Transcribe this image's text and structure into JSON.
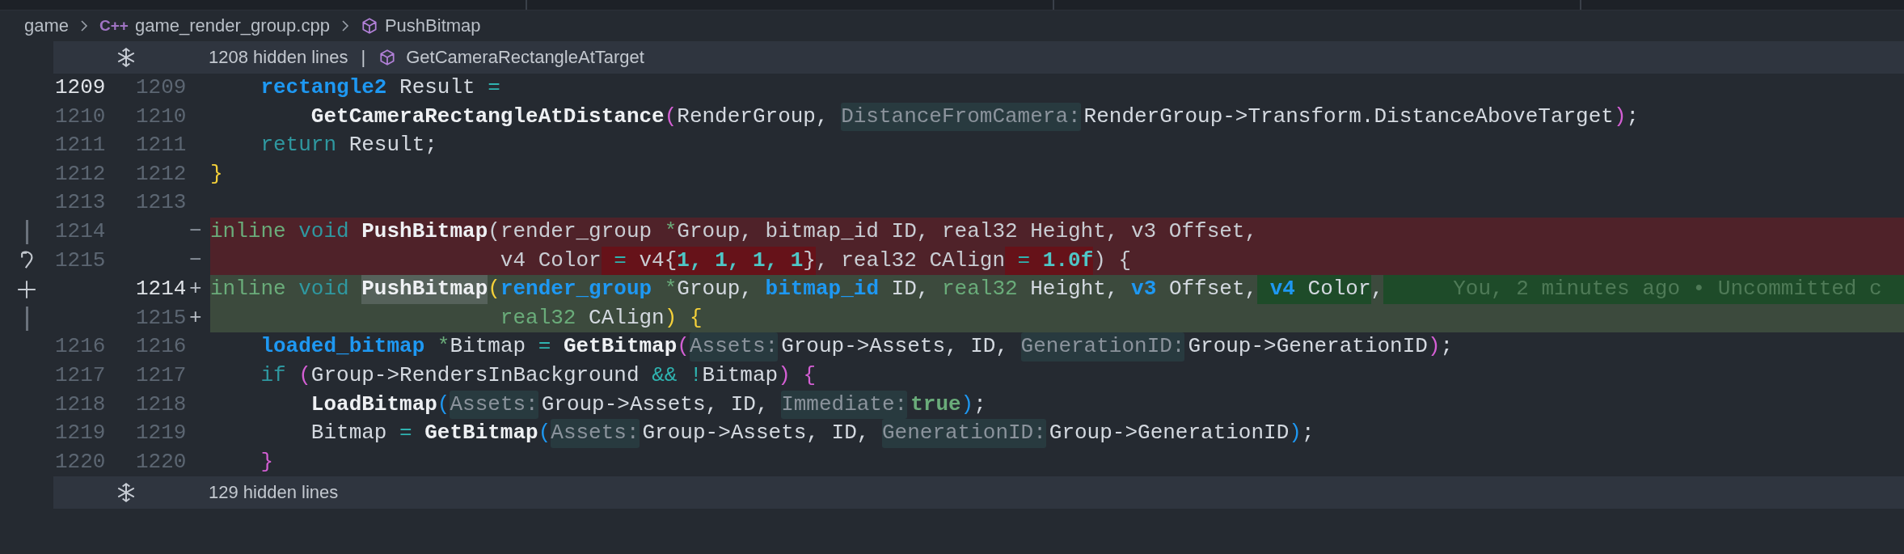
{
  "breadcrumb": [
    {
      "label": "game",
      "kind": "folder"
    },
    {
      "label": "game_render_group.cpp",
      "kind": "file",
      "icon_text": "C++"
    },
    {
      "label": "PushBitmap",
      "kind": "symbol"
    }
  ],
  "top_fold": {
    "label": "1208 hidden lines",
    "separator": "|",
    "symbol": "GetCameraRectangleAtTarget"
  },
  "lines": [
    {
      "old": "1209",
      "new": "1209",
      "kind": "context",
      "current": true,
      "tokens": [
        {
          "t": "    rectangle2",
          "kind": "type"
        },
        {
          "t": " Result ",
          "kind": "plain"
        },
        {
          "t": "=",
          "kind": "op"
        }
      ]
    },
    {
      "old": "1210",
      "new": "1210",
      "kind": "context",
      "current": false,
      "tokens": [
        {
          "t": "        GetCameraRectangleAtDistance",
          "kind": "func"
        },
        {
          "t": "(",
          "kind": "pink"
        },
        {
          "t": "RenderGroup, ",
          "kind": "plain"
        },
        {
          "t": "DistanceFromCamera:",
          "kind": "hint"
        },
        {
          "t": "RenderGroup->Transform.DistanceAboveTarget",
          "kind": "plain"
        },
        {
          "t": ")",
          "kind": "pink"
        },
        {
          "t": ";",
          "kind": "plain"
        }
      ]
    },
    {
      "old": "1211",
      "new": "1211",
      "kind": "context",
      "current": false,
      "tokens": [
        {
          "t": "    return",
          "kind": "kw"
        },
        {
          "t": " Result;",
          "kind": "plain"
        }
      ]
    },
    {
      "old": "1212",
      "new": "1212",
      "kind": "context",
      "current": false,
      "tokens": [
        {
          "t": "}",
          "kind": "yellow"
        }
      ]
    },
    {
      "old": "1213",
      "new": "1213",
      "kind": "context",
      "current": false
    },
    {
      "old": "1214",
      "kind": "deleted",
      "sign": "−",
      "gutter": {
        "kind": "bar"
      },
      "current": false,
      "tokens": [
        {
          "t": "inline",
          "kind": "green"
        },
        {
          "t": " void",
          "kind": "kw"
        },
        {
          "t": " PushBitmap",
          "kind": "func"
        },
        {
          "t": "(render_group ",
          "kind": "plain"
        },
        {
          "t": "*",
          "kind": "ptr"
        },
        {
          "t": "Group, bitmap_id ID, real32 Height, v3 Offset,",
          "kind": "plain"
        }
      ]
    },
    {
      "old": "1215",
      "kind": "deleted",
      "sign": "−",
      "gutter": {
        "kind": "revert"
      },
      "current": false,
      "tokens": [
        {
          "t": "                       v4 Color",
          "kind": "plain"
        },
        {
          "t": " =",
          "kind": "op",
          "changed": true
        },
        {
          "t": " v4{",
          "kind": "plain",
          "changed": true
        },
        {
          "t": "1, 1, 1, 1",
          "kind": "num",
          "changed": true
        },
        {
          "t": "}",
          "kind": "plain",
          "changed": true
        },
        {
          "t": ", real32 CAlign",
          "kind": "plain"
        },
        {
          "t": " =",
          "kind": "op",
          "changed": true
        },
        {
          "t": " 1.0f",
          "kind": "num",
          "changed": true
        },
        {
          "t": ") {",
          "kind": "plain"
        }
      ]
    },
    {
      "new": "1214",
      "kind": "added",
      "sign": "+",
      "gutter": {
        "kind": "plus"
      },
      "current": true,
      "blame": "You, 2 minutes ago • Uncommitted c",
      "tokens": [
        {
          "t": "inline",
          "kind": "green"
        },
        {
          "t": " void ",
          "kind": "kw"
        },
        {
          "t": "PushBitmap",
          "kind": "func",
          "changed": true
        },
        {
          "t": "(",
          "kind": "yellow"
        },
        {
          "t": "render_group",
          "kind": "type"
        },
        {
          "t": " *",
          "kind": "ptr"
        },
        {
          "t": "Group, ",
          "kind": "plain"
        },
        {
          "t": "bitmap_id",
          "kind": "type"
        },
        {
          "t": " ID, ",
          "kind": "plain"
        },
        {
          "t": "real32",
          "kind": "green"
        },
        {
          "t": " Height, ",
          "kind": "plain"
        },
        {
          "t": "v3",
          "kind": "type"
        },
        {
          "t": " Offset,",
          "kind": "plain"
        },
        {
          "t": " v4",
          "kind": "type",
          "changed": true
        },
        {
          "t": " Color",
          "kind": "plain",
          "changed": true
        },
        {
          "t": ",",
          "kind": "plain"
        }
      ]
    },
    {
      "new": "1215",
      "kind": "added",
      "sign": "+",
      "gutter": {
        "kind": "bar"
      },
      "current": false,
      "tokens": [
        {
          "t": "                       real32",
          "kind": "green"
        },
        {
          "t": " CAlign",
          "kind": "plain"
        },
        {
          "t": ")",
          "kind": "yellow"
        },
        {
          "t": " {",
          "kind": "yellow"
        }
      ]
    },
    {
      "old": "1216",
      "new": "1216",
      "kind": "context",
      "current": false,
      "tokens": [
        {
          "t": "    loaded_bitmap",
          "kind": "type"
        },
        {
          "t": " *",
          "kind": "ptr"
        },
        {
          "t": "Bitmap ",
          "kind": "plain"
        },
        {
          "t": "=",
          "kind": "op"
        },
        {
          "t": " GetBitmap",
          "kind": "func"
        },
        {
          "t": "(",
          "kind": "pink"
        },
        {
          "t": "Assets:",
          "kind": "hint"
        },
        {
          "t": "Group->Assets, ID, ",
          "kind": "plain"
        },
        {
          "t": "GenerationID:",
          "kind": "hint"
        },
        {
          "t": "Group->GenerationID",
          "kind": "plain"
        },
        {
          "t": ")",
          "kind": "pink"
        },
        {
          "t": ";",
          "kind": "plain"
        }
      ]
    },
    {
      "old": "1217",
      "new": "1217",
      "kind": "context",
      "current": false,
      "tokens": [
        {
          "t": "    if",
          "kind": "kw"
        },
        {
          "t": " (",
          "kind": "pink"
        },
        {
          "t": "Group->RendersInBackground ",
          "kind": "plain"
        },
        {
          "t": "&& !",
          "kind": "op"
        },
        {
          "t": "Bitmap",
          "kind": "plain"
        },
        {
          "t": ")",
          "kind": "pink"
        },
        {
          "t": " {",
          "kind": "pink"
        }
      ]
    },
    {
      "old": "1218",
      "new": "1218",
      "kind": "context",
      "current": false,
      "tokens": [
        {
          "t": "        LoadBitmap",
          "kind": "func"
        },
        {
          "t": "(",
          "kind": "blue"
        },
        {
          "t": "Assets:",
          "kind": "hint"
        },
        {
          "t": "Group->Assets, ID, ",
          "kind": "plain"
        },
        {
          "t": "Immediate:",
          "kind": "hint"
        },
        {
          "t": "true",
          "kind": "bool"
        },
        {
          "t": ")",
          "kind": "blue"
        },
        {
          "t": ";",
          "kind": "plain"
        }
      ]
    },
    {
      "old": "1219",
      "new": "1219",
      "kind": "context",
      "current": false,
      "tokens": [
        {
          "t": "        Bitmap ",
          "kind": "plain"
        },
        {
          "t": "=",
          "kind": "op"
        },
        {
          "t": " GetBitmap",
          "kind": "func"
        },
        {
          "t": "(",
          "kind": "blue"
        },
        {
          "t": "Assets:",
          "kind": "hint"
        },
        {
          "t": "Group->Assets, ID, ",
          "kind": "plain"
        },
        {
          "t": "GenerationID:",
          "kind": "hint"
        },
        {
          "t": "Group->GenerationID",
          "kind": "plain"
        },
        {
          "t": ")",
          "kind": "blue"
        },
        {
          "t": ";",
          "kind": "plain"
        }
      ]
    },
    {
      "old": "1220",
      "new": "1220",
      "kind": "context",
      "current": false,
      "tokens": [
        {
          "t": "    }",
          "kind": "pink"
        }
      ]
    }
  ],
  "bottom_fold": {
    "label": "129 hidden lines"
  }
}
